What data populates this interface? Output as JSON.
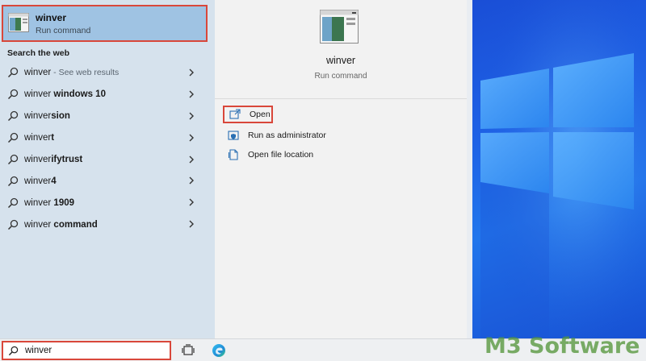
{
  "best_match": {
    "title": "winver",
    "subtitle": "Run command",
    "icon": "run-command-icon"
  },
  "search_web": {
    "heading": "Search the web",
    "items": [
      {
        "query": "winver",
        "completion": "",
        "suffix": " - See web results"
      },
      {
        "query": "winver",
        "completion": " windows 10",
        "suffix": ""
      },
      {
        "query": "winver",
        "completion": "sion",
        "suffix": ""
      },
      {
        "query": "winver",
        "completion": "t",
        "suffix": ""
      },
      {
        "query": "winver",
        "completion": "ifytrust",
        "suffix": ""
      },
      {
        "query": "winver",
        "completion": "4",
        "suffix": ""
      },
      {
        "query": "winver",
        "completion": " 1909",
        "suffix": ""
      },
      {
        "query": "winver",
        "completion": " command",
        "suffix": ""
      }
    ]
  },
  "detail": {
    "title": "winver",
    "subtitle": "Run command",
    "actions": [
      {
        "label": "Open",
        "icon": "open-icon"
      },
      {
        "label": "Run as administrator",
        "icon": "shield-icon"
      },
      {
        "label": "Open file location",
        "icon": "file-icon"
      }
    ]
  },
  "taskbar": {
    "search_value": "winver",
    "taskview_icon": "task-view-icon",
    "edge_icon": "edge-browser-icon"
  },
  "watermark": "M3 Software",
  "colors": {
    "highlight_border": "#d9473a",
    "best_match_bg": "#9fc3e3",
    "left_pane_bg": "#d6e2ed",
    "desktop_blue": "#1e62e6",
    "watermark_green": "#56963c"
  }
}
